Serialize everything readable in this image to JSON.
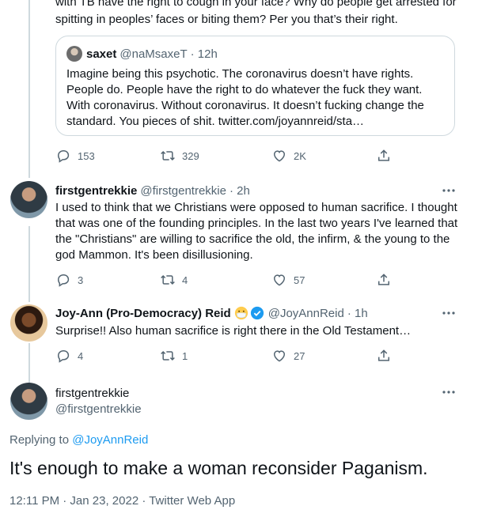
{
  "thread_top": {
    "text": "with TB have the right to cough in your face? Why do people get arrested for spitting in peoples’ faces or biting them? Per you that’s their right.",
    "quote": {
      "name": "saxet",
      "handle": "@naMsaxeT",
      "time": "· 12h",
      "text": "Imagine being this psychotic. The coronavirus doesn’t have rights. People do. People have the right to do whatever the fuck they want. With coronavirus. Without coronavirus. It doesn’t fucking change the standard. You pieces of shit. twitter.com/joyannreid/sta…"
    },
    "stats": {
      "replies": "153",
      "retweets": "329",
      "likes": "2K"
    }
  },
  "reply1": {
    "name": "firstgentrekkie",
    "handle": "@firstgentrekkie",
    "time": "· 2h",
    "text": "I used to think that we Christians were opposed to human sacrifice. I thought that was one of the founding principles. In the last two years I've learned that the \"Christians\" are willing to sacrifice the old, the infirm, & the young to the god Mammon. It's been disillusioning.",
    "stats": {
      "replies": "3",
      "retweets": "4",
      "likes": "57"
    }
  },
  "reply2": {
    "name": "Joy-Ann (Pro-Democracy) Reid",
    "handle": "@JoyAnnReid",
    "time": "· 1h",
    "text": "Surprise!! Also human sacrifice is right there in the Old Testament…",
    "stats": {
      "replies": "4",
      "retweets": "1",
      "likes": "27"
    }
  },
  "focused": {
    "name": "firstgentrekkie",
    "handle": "@firstgentrekkie",
    "replying_prefix": "Replying to ",
    "replying_handle": "@JoyAnnReid",
    "text": "It's enough to make a woman reconsider Paganism.",
    "meta": "12:11 PM · Jan 23, 2022 · Twitter Web App"
  },
  "icons": [
    "reply-icon",
    "retweet-icon",
    "like-icon",
    "share-icon",
    "more-icon",
    "verified-badge-icon",
    "mask-emoji-icon"
  ],
  "colors": {
    "text": "#0f1419",
    "muted": "#536471",
    "link": "#1d9bf0",
    "border": "#cfd9de",
    "verified": "#1d9bf0"
  }
}
